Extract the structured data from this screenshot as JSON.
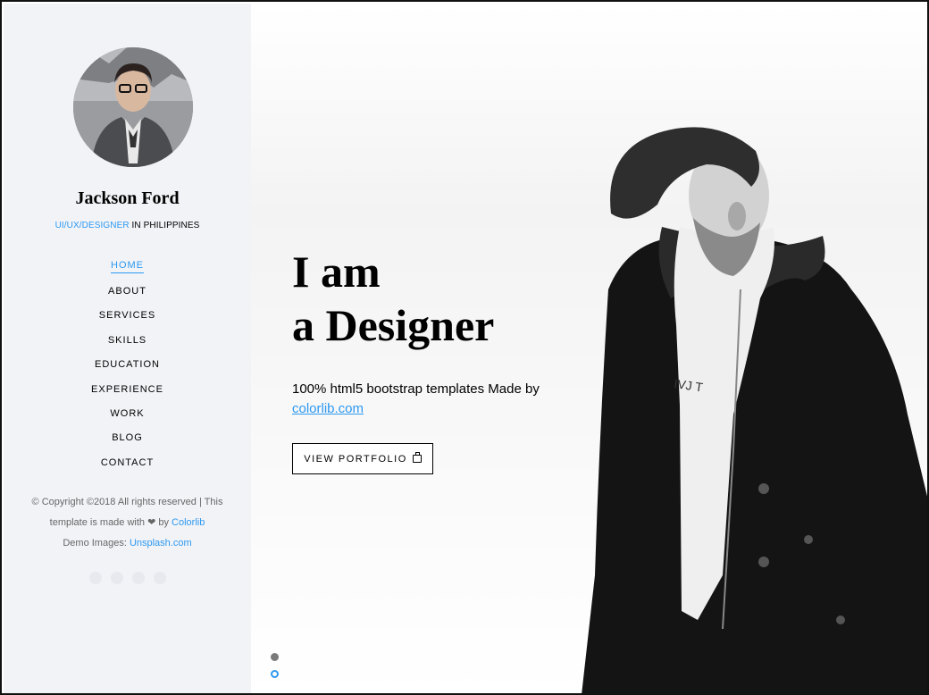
{
  "profile": {
    "name": "Jackson Ford",
    "role": "UI/UX/DESIGNER",
    "location": " IN PHILIPPINES"
  },
  "nav": {
    "items": [
      "HOME",
      "ABOUT",
      "SERVICES",
      "SKILLS",
      "EDUCATION",
      "EXPERIENCE",
      "WORK",
      "BLOG",
      "CONTACT"
    ],
    "active": "HOME"
  },
  "footer": {
    "copyright": "© Copyright ©2018 All rights reserved | This template is made with ❤ by ",
    "credit_link": "Colorlib",
    "demo_prefix": "Demo Images: ",
    "demo_link": "Unsplash.com"
  },
  "hero": {
    "headline_line1": "I am",
    "headline_line2": "a Designer",
    "subtext": "100% html5 bootstrap templates Made by ",
    "subtext_link": "colorlib.com",
    "button_label": "VIEW PORTFOLIO"
  },
  "colors": {
    "accent": "#2c98f0",
    "sidebar_bg": "#f2f3f7"
  },
  "icons": {
    "button_icon": "briefcase-icon",
    "social": [
      "facebook-icon",
      "twitter-icon",
      "instagram-icon",
      "linkedin-icon"
    ]
  }
}
